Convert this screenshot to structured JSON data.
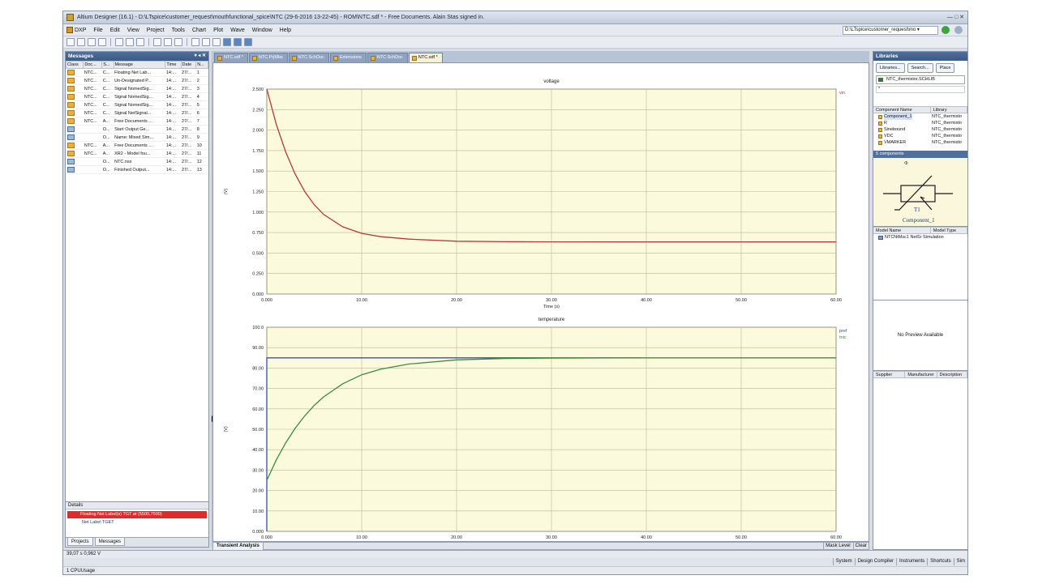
{
  "window": {
    "title": "Altium Designer (16.1) - D:\\LTspice\\customer_request\\mouthfunctional_spice\\NTC (29-6-2016 13-22-45) - ROM\\NTC.sdf * - Free Documents. Alain Stas signed in.",
    "controls": "— □ ✕"
  },
  "menu": {
    "items": [
      "DXP",
      "File",
      "Edit",
      "View",
      "Project",
      "Tools",
      "Chart",
      "Plot",
      "Wave",
      "Window",
      "Help"
    ],
    "path_value": "D:\\LTspice\\customer_request\\mo ▾"
  },
  "messages_panel": {
    "title": "Messages",
    "controls": "▾ ◂ ✕",
    "columns": [
      "Class",
      "Doc...",
      "S...",
      "Message",
      "Time",
      "Date",
      "N..."
    ],
    "rows": [
      {
        "cls": "warn",
        "doc": "NTC...",
        "s": "C...",
        "msg": "Floating Net Lab...",
        "time": "14:...",
        "date": "27/...",
        "n": "1"
      },
      {
        "cls": "warn",
        "doc": "NTC...",
        "s": "C...",
        "msg": "Un-Designated P...",
        "time": "14:...",
        "date": "27/...",
        "n": "2"
      },
      {
        "cls": "warn",
        "doc": "NTC...",
        "s": "C...",
        "msg": "Signal NomedSig...",
        "time": "14:...",
        "date": "27/...",
        "n": "3"
      },
      {
        "cls": "warn",
        "doc": "NTC...",
        "s": "C...",
        "msg": "Signal NomedSig...",
        "time": "14:...",
        "date": "27/...",
        "n": "4"
      },
      {
        "cls": "warn",
        "doc": "NTC...",
        "s": "C...",
        "msg": "Signal NomedSig...",
        "time": "14:...",
        "date": "27/...",
        "n": "5"
      },
      {
        "cls": "warn",
        "doc": "NTC...",
        "s": "C...",
        "msg": "Signal NetSignal...",
        "time": "14:...",
        "date": "27/...",
        "n": "6"
      },
      {
        "cls": "warn",
        "doc": "NTC...",
        "s": "A...",
        "msg": "Free Documents ...",
        "time": "14:...",
        "date": "27/...",
        "n": "7"
      },
      {
        "cls": "info",
        "doc": "",
        "s": "O...",
        "msg": "Start Output Ge...",
        "time": "14:...",
        "date": "27/...",
        "n": "8"
      },
      {
        "cls": "info",
        "doc": "",
        "s": "O...",
        "msg": "Name: Mixed Sim...",
        "time": "14:...",
        "date": "27/...",
        "n": "9"
      },
      {
        "cls": "warn",
        "doc": "NTC...",
        "s": "A...",
        "msg": "Free Documents ...",
        "time": "14:...",
        "date": "27/...",
        "n": "10"
      },
      {
        "cls": "warn",
        "doc": "NTC...",
        "s": "A...",
        "msg": "XR2 - Model fou...",
        "time": "14:...",
        "date": "27/...",
        "n": "11"
      },
      {
        "cls": "info",
        "doc": "",
        "s": "O...",
        "msg": "NTC.nsx",
        "time": "14:...",
        "date": "27/...",
        "n": "12"
      },
      {
        "cls": "info",
        "doc": "",
        "s": "O...",
        "msg": "Finished Output...",
        "time": "14:...",
        "date": "27/...",
        "n": "13"
      }
    ],
    "details_title": "Details",
    "detail_error": "Floating Net Label(s) TGT at (5500,7500)",
    "detail_sub": "Net Label TGET",
    "tabs": [
      "Projects",
      "Messages"
    ]
  },
  "doc_tabs": [
    {
      "label": "NTC.sdf *",
      "active": false
    },
    {
      "label": "NTC.PrjMbs",
      "active": false
    },
    {
      "label": "NTC.SchDoc",
      "active": false
    },
    {
      "label": "Extensions",
      "active": false
    },
    {
      "label": "NTC.SchDoc",
      "active": false
    },
    {
      "label": "NTC.sdf *",
      "active": true
    }
  ],
  "plot_bottom": {
    "tab": "Transient Analysis",
    "right_items": [
      "Mask Level",
      "Clear"
    ]
  },
  "chart_data": [
    {
      "type": "line",
      "title": "voltage",
      "xlabel": "Time (s)",
      "ylabel": "(V)",
      "xlim": [
        0,
        60
      ],
      "ylim": [
        0,
        2.5
      ],
      "x_ticks": [
        "0.000",
        "10.00",
        "20.00",
        "30.00",
        "40.00",
        "50.00",
        "60.00"
      ],
      "y_ticks": [
        "0.000",
        "0.250",
        "0.500",
        "0.750",
        "1.000",
        "1.250",
        "1.500",
        "1.750",
        "2.000",
        "2.250",
        "2.500"
      ],
      "grid": true,
      "legend": "top-right",
      "series": [
        {
          "name": "vin",
          "color": "#b33a3a",
          "x": [
            0,
            1,
            2,
            3,
            4,
            5,
            6,
            8,
            10,
            12,
            15,
            20,
            25,
            30,
            40,
            50,
            60
          ],
          "values": [
            2.5,
            2.07,
            1.73,
            1.46,
            1.25,
            1.09,
            0.97,
            0.82,
            0.74,
            0.7,
            0.67,
            0.644,
            0.638,
            0.636,
            0.635,
            0.635,
            0.635
          ]
        }
      ]
    },
    {
      "type": "line",
      "title": "temperature",
      "xlabel": "Time (s)",
      "ylabel": "(V)",
      "xlim": [
        0,
        60
      ],
      "ylim": [
        0,
        100
      ],
      "x_ticks": [
        "0.000",
        "10.00",
        "20.00",
        "30.00",
        "40.00",
        "50.00",
        "60.00"
      ],
      "y_ticks": [
        "0.000",
        "10.00",
        "20.00",
        "30.00",
        "40.00",
        "50.00",
        "60.00",
        "70.00",
        "80.00",
        "90.00",
        "100.0"
      ],
      "grid": true,
      "legend": "top-right",
      "series": [
        {
          "name": "pref",
          "color": "#3b4ea8",
          "x": [
            0,
            0.001,
            39.5
          ],
          "values": [
            0,
            85,
            85
          ]
        },
        {
          "name": "tntc",
          "color": "#3f8a3f",
          "x": [
            0,
            1,
            2,
            3,
            4,
            5,
            6,
            8,
            10,
            12,
            15,
            20,
            25,
            30,
            40,
            50,
            60
          ],
          "values": [
            25,
            35,
            43.4,
            50.6,
            56.6,
            61.7,
            65.9,
            72.3,
            76.7,
            79.5,
            82.0,
            84.0,
            84.7,
            84.9,
            85.0,
            85.0,
            85.0
          ]
        }
      ]
    }
  ],
  "libraries_panel": {
    "title": "Libraries",
    "buttons": [
      "Libraries...",
      "Search...",
      "Place"
    ],
    "selected_library": "NTC_thermistor.SCHLIB",
    "filter_value": "*",
    "component_headers": [
      "Component Name",
      "Library"
    ],
    "components": [
      {
        "name": "Component_1",
        "library": "NTC_thermisto",
        "selected": true
      },
      {
        "name": "R",
        "library": "NTC_thermisto",
        "selected": false
      },
      {
        "name": "Sinebound",
        "library": "NTC_thermisto",
        "selected": false
      },
      {
        "name": "VDC",
        "library": "NTC_thermisto",
        "selected": false
      },
      {
        "name": "VMARKER",
        "library": "NTC_thermisto",
        "selected": false
      }
    ],
    "components_count": "5 components",
    "symbol_ref": "T1",
    "symbol_name": "Component_1",
    "symbol_top": "Ф",
    "model_headers": [
      "Model Name",
      "Model Type"
    ],
    "model_row": "NTCNtMsc1 NetSr Simulation",
    "preview_text": "No Preview Available",
    "supplier_headers": [
      "Supplier",
      "Manufacturer",
      "Description"
    ]
  },
  "status": {
    "coords": "39,07 s 0,962 V",
    "right_items": [
      "System",
      "Design Compiler",
      "Instruments",
      "Shortcuts",
      "Sim"
    ],
    "bottom": "1 CPUUsage"
  },
  "colors": {
    "plot_bg": "#fcfadc",
    "grid": "#b9b79a",
    "voltage_trace": "#b33a3a",
    "pref_trace": "#3b4ea8",
    "tntc_trace": "#3f8a3f",
    "panel_header": "#3c5a86",
    "error_row": "#e12a2a"
  }
}
